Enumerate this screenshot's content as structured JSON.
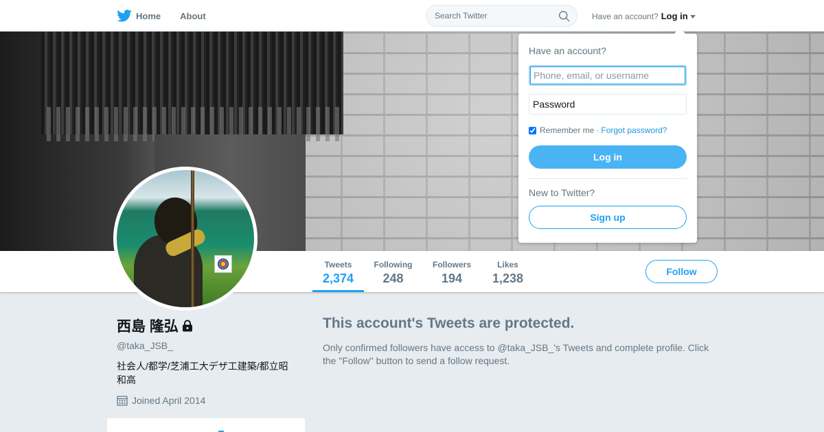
{
  "nav": {
    "home_label": "Home",
    "about_label": "About",
    "search_placeholder": "Search Twitter",
    "account_prompt": "Have an account?",
    "login_label": "Log in",
    "icons": {
      "logo": "twitter-bird-icon",
      "search": "search-icon",
      "caret": "caret-down-icon"
    },
    "brand_color": "#1da1f2"
  },
  "profile": {
    "name": "西島 隆弘",
    "screen_name": "@taka_JSB_",
    "bio": "社会人/都学/芝浦工大デザ工建築/都立昭和高",
    "joined": "Joined April 2014",
    "protected_icon": "lock-icon",
    "calendar_icon": "calendar-icon"
  },
  "stats": [
    {
      "label": "Tweets",
      "value": "2,374",
      "active": true
    },
    {
      "label": "Following",
      "value": "248",
      "active": false
    },
    {
      "label": "Followers",
      "value": "194",
      "active": false
    },
    {
      "label": "Likes",
      "value": "1,238",
      "active": false
    }
  ],
  "follow_label": "Follow",
  "protected": {
    "title": "This account's Tweets are protected.",
    "message": "Only confirmed followers have access to @taka_JSB_'s Tweets and complete profile. Click the \"Follow\" button to send a follow request."
  },
  "login_dropdown": {
    "title": "Have an account?",
    "username_placeholder": "Phone, email, or username",
    "password_placeholder": "Password",
    "remember_label": "Remember me",
    "remember_checked": true,
    "separator": "·",
    "forgot_label": "Forgot password?",
    "login_button": "Log in",
    "new_prompt": "New to Twitter?",
    "signup_button": "Sign up"
  }
}
